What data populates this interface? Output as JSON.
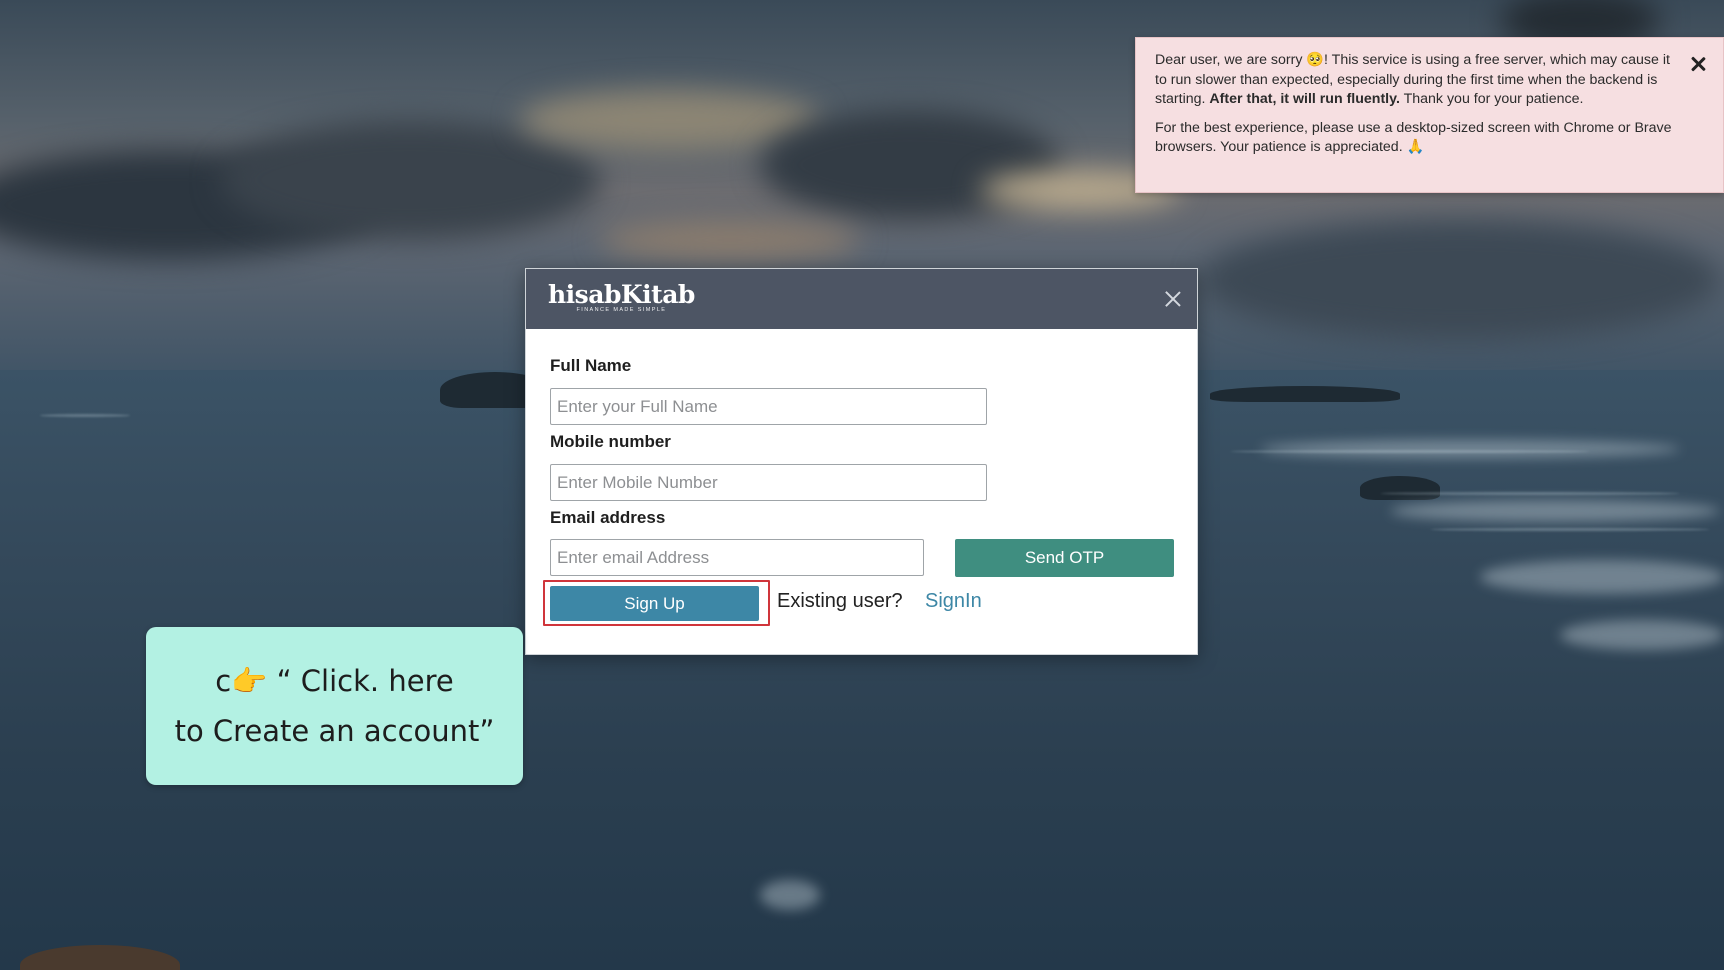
{
  "notice": {
    "paragraph1_before": "Dear user, we are sorry 🥺! This service is using a free server, which may cause it to run slower than expected, especially during the first time when the backend is starting. ",
    "paragraph1_bold": "After that, it will run fluently.",
    "paragraph1_after": " Thank you for your patience.",
    "paragraph2": "For the best experience, please use a desktop-sized screen with Chrome or Brave browsers. Your patience is appreciated. 🙏",
    "close_icon": "close-icon"
  },
  "modal": {
    "logo": "hisabKitab",
    "logo_tagline": "FINANCE MADE SIMPLE",
    "close_icon": "close-icon",
    "full_name": {
      "label": "Full Name",
      "placeholder": "Enter your Full Name",
      "value": ""
    },
    "mobile": {
      "label": "Mobile number",
      "placeholder": "Enter Mobile Number",
      "value": ""
    },
    "email": {
      "label": "Email address",
      "placeholder": "Enter email Address",
      "value": ""
    },
    "send_otp_label": "Send OTP",
    "signup_label": "Sign Up",
    "existing_user_text": "Existing user?",
    "signin_label": "SignIn"
  },
  "callout": {
    "line1": "c👉 “ Click. here",
    "line2": "to Create an account”"
  },
  "colors": {
    "header_bg": "#4d5564",
    "otp_button": "#3f8e80",
    "signup_button": "#3d87a6",
    "highlight_border": "#d0353b",
    "notice_bg": "#f6dfe1",
    "callout_bg": "#b3f1e3"
  }
}
